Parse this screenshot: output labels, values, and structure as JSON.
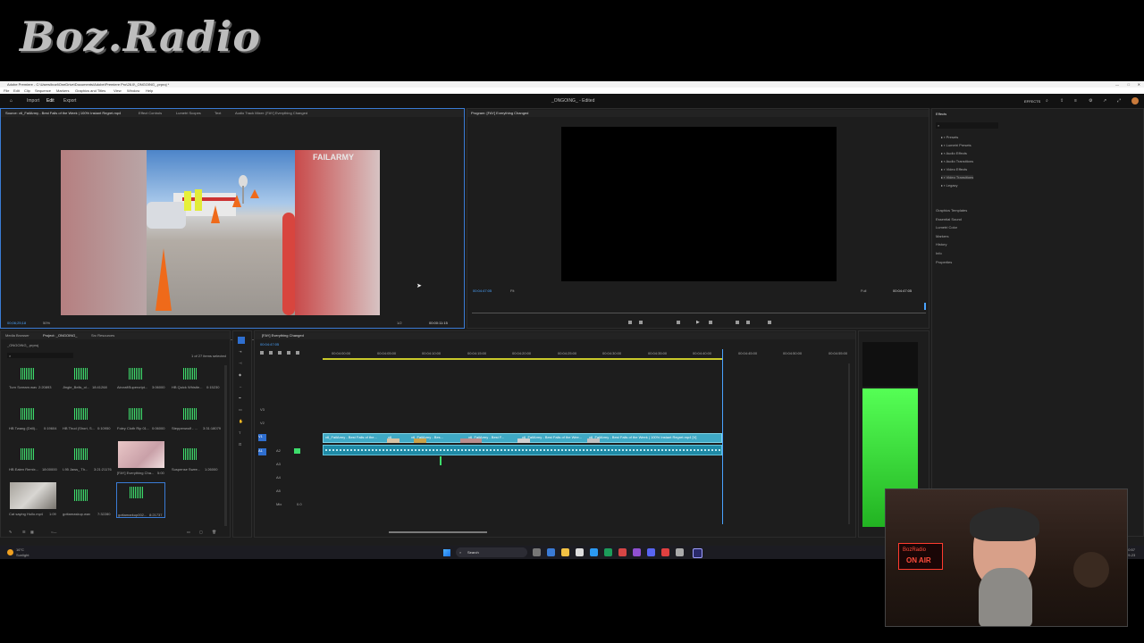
{
  "overlay": {
    "logo_text": "Boz.Radio"
  },
  "window": {
    "title": "Adobe Premiere - C:\\Users\\bozt\\OneDrive\\Documents\\Adobe\\Premiere Pro\\26.0\\_ONGOING_.prproj *"
  },
  "menu": [
    "File",
    "Edit",
    "Clip",
    "Sequence",
    "Markers",
    "Graphics and Titles",
    "View",
    "Window",
    "Help"
  ],
  "topnav": {
    "tabs": [
      "Import",
      "Edit",
      "Export"
    ],
    "project_title": "_ONGOING_ - Edited",
    "workspace_label": "EFFECTS"
  },
  "source_panel": {
    "tabs": [
      "Source: v6_FailArmy - Best Fails of the Week | 100% Instant Regret.mp4",
      "Effect Controls",
      "Lumetri Scopes",
      "Text",
      "Audio Track Mixer: [FAY] Everything Changed"
    ],
    "timecode_left": "00;06;25;18",
    "zoom": "50%",
    "resolution": "1/2",
    "timecode_right": "00:00:11:15",
    "watermark": "FAILARMY"
  },
  "program_panel": {
    "tab": "Program: [FAY] Everything Changed",
    "timecode_left": "00:04:47:05",
    "fit": "Fit",
    "quality": "Full",
    "timecode_right": "00:04:47:05"
  },
  "effects_panel": {
    "title": "Effects",
    "folders": [
      "Presets",
      "Lumetri Presets",
      "Audio Effects",
      "Audio Transitions",
      "Video Effects",
      "Video Transitions",
      "Legacy"
    ],
    "sections": [
      "Graphics Templates",
      "Essential Sound",
      "Lumetri Color",
      "Markers",
      "History",
      "Info",
      "Properties"
    ]
  },
  "project_panel": {
    "tabs": [
      "Media Browser",
      "Project: _ONGOING_",
      "Src Resources"
    ],
    "file": "_ONGOING_.prproj",
    "selection": "1 of 27 items selected",
    "items": [
      {
        "name": "Turn Scream.wav",
        "dur": "2:20893"
      },
      {
        "name": "Jingle_Bells_ol...",
        "dur": "18:41268"
      },
      {
        "name": "AircraftSupercript...",
        "dur": "3:06000"
      },
      {
        "name": "HB Quick Whistle...",
        "dur": "0:15230"
      },
      {
        "name": "HB Twang (Drill)...",
        "dur": "0:19604"
      },
      {
        "name": "HB Thud (Short, S...",
        "dur": "0:10950"
      },
      {
        "name": "Foley Cloth Rip 01...",
        "dur": "0:06000"
      },
      {
        "name": "Steppenwolf - ...",
        "dur": "3:31:18079"
      },
      {
        "name": "HB Eaten Remix...",
        "dur": "18:00000"
      },
      {
        "name": "I-95 Jaws_ Th...",
        "dur": "3:21:21176"
      },
      {
        "name": "[FAY] Everything Cha...",
        "dur": "5:00"
      },
      {
        "name": "Suspense Swee...",
        "dur": "1:26000"
      },
      {
        "name": "Cat saying Hullo.mp4",
        "dur": "1:09"
      },
      {
        "name": "gottamaskup.wav",
        "dur": "7:32280"
      },
      {
        "name": "gottamarkup002...",
        "dur": "8:21737"
      }
    ]
  },
  "timeline": {
    "tab": "[FAY] Everything Changed",
    "timecode": "00:04:47:05",
    "ruler": [
      "00:04:00:00",
      "00:04:05:00",
      "00:04:10:00",
      "00:04:15:00",
      "00:04:20:00",
      "00:04:25:00",
      "00:04:30:00",
      "00:04:35:00",
      "00:04:40:00",
      "00:04:45:00",
      "00:04:50:00",
      "00:04:55:00",
      "00:05:00:00"
    ],
    "tracks": [
      "V3",
      "V2",
      "V1",
      "A1",
      "A2",
      "A3",
      "A4",
      "A5"
    ],
    "mix_label": "Mix",
    "mix_value": "0.0",
    "clips": [
      {
        "label": "v6_FailArmy - Best Fails of the..."
      },
      {
        "label": "v6_"
      },
      {
        "label": "v6_FailArmy - Bes..."
      },
      {
        "label": "v6_FailArmy - Best F..."
      },
      {
        "label": "v6_FailArmy - Best Fails of the Wee..."
      },
      {
        "label": "v6_FailArmy - Best Fails of the Week | 100% Instant Regret.mp4 [V]"
      }
    ]
  },
  "taskbar": {
    "weather_temp": "16°C",
    "weather_desc": "Sunlight",
    "search": "Search",
    "time": "20:57",
    "date": "09-23"
  },
  "webcam": {
    "sign_top": "BozRadio",
    "sign_bottom": "ON AIR"
  },
  "colors": {
    "accent": "#4aa3ff",
    "clip_video": "#3fa9c5",
    "clip_audio": "#1f8aa6",
    "meter": "#55ff55"
  }
}
